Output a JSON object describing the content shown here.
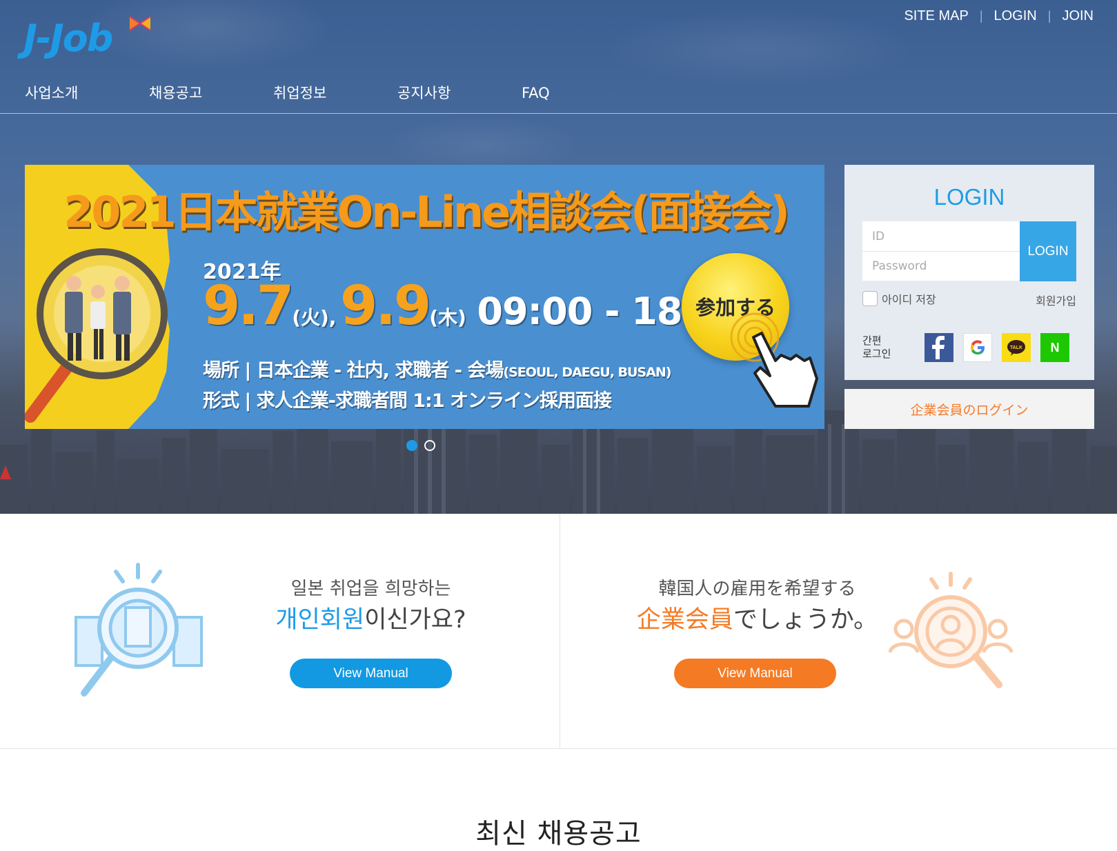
{
  "brand": {
    "logo_text": "J-Job",
    "accent": "#1e9be7",
    "orange": "#f57a24"
  },
  "util_nav": {
    "site_map": "SITE MAP",
    "login": "LOGIN",
    "join": "JOIN"
  },
  "gnb": [
    "사업소개",
    "채용공고",
    "취업정보",
    "공지사항",
    "FAQ"
  ],
  "banner": {
    "title": "2021日本就業On-Line相談会(面接会)",
    "year": "2021年",
    "date1": "9.7",
    "dow1": "(火),",
    "date2": "9.9",
    "dow2": "(木)",
    "time": "09:00 - 18:00",
    "place_label": "場所 | 日本企業 - 社内, 求職者 - 会場",
    "place_cities": "(SEOUL, DAEGU, BUSAN)",
    "format_line": "形式 | 求人企業-求職者間 1:1 オンライン採用面接",
    "cta": "参加する"
  },
  "carousel": {
    "slide_count": 2,
    "active_index": 0
  },
  "login": {
    "title": "LOGIN",
    "id_placeholder": "ID",
    "pw_placeholder": "Password",
    "button": "LOGIN",
    "save_id": "아이디 저장",
    "join": "회원가입",
    "easy_login": "간편\n로그인",
    "socials": [
      "facebook-icon",
      "google-icon",
      "kakaotalk-icon",
      "naver-icon"
    ],
    "corp_login": "企業会員のログイン"
  },
  "members": {
    "personal": {
      "line1": "일본 취업을 희망하는",
      "highlight": "개인회원",
      "rest": "이신가요?",
      "button": "View Manual"
    },
    "corporate": {
      "line1": "韓国人の雇用を希望する",
      "highlight": "企業会員",
      "rest": "でしょうか。",
      "button": "View Manual"
    }
  },
  "recent": {
    "title": "최신 채용공고"
  }
}
